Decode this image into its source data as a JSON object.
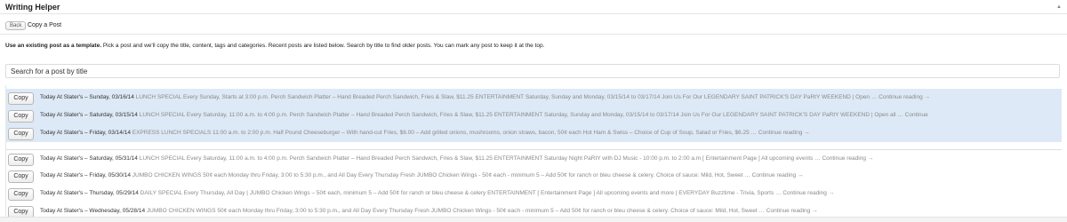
{
  "panel": {
    "title": "Writing Helper",
    "toggle_glyph": "▲"
  },
  "subbar": {
    "back_label": "Back",
    "crumb": "Copy a Post"
  },
  "intro": {
    "bold": "Use an existing post as a template.",
    "rest": " Pick a post and we'll copy the title, content, tags and categories. Recent posts are listed below. Search by title to find older posts. You can mark any post to keep it at the top."
  },
  "search": {
    "placeholder": "Search for a post by title",
    "value": ""
  },
  "copy_label": "Copy",
  "posts": [
    {
      "title": "Today At Slater's – Sunday, 03/16/14",
      "excerpt": "LUNCH SPECIAL Every Sunday, Starts at 3:00 p.m. Perch Sandwich Platter – Hand Breaded Perch Sandwich, Fries & Slaw, $11.25 ENTERTAINMENT Saturday, Sunday and Monday, 03/15/14 to 03/17/14 Join Us For Our LEGENDARY SAINT PATRICK'S DAY PaRtY WEEKEND | Open …",
      "more": "Continue reading →",
      "highlighted": true
    },
    {
      "title": "Today At Slater's – Saturday, 03/15/14",
      "excerpt": "LUNCH SPECIAL Every Saturday, 11:00 a.m. to 4:00 p.m. Perch Sandwich Platter – Hand Breaded Perch Sandwich, Fries & Slaw, $11.25 ENTERTAINMENT Saturday, Sunday and Monday, 03/15/14 to 03/17/14 Join Us For Our LEGENDARY SAINT PATRICK'S DAY PaRtY WEEKEND | Open all …",
      "more": "Continue",
      "highlighted": true
    },
    {
      "title": "Today At Slater's – Friday, 03/14/14",
      "excerpt": "EXPRESS LUNCH SPECIALS 11:00 a.m. to 2:00 p.m. Half Pound Cheeseburger – With hand-cut Fries, $6.00 – Add grilled onions, mushrooms, onion straws, bacon, 50¢ each Hot Ham & Swiss – Choice of Cup of Soup, Salad or Fries, $6.25 …",
      "more": "Continue reading →",
      "highlighted": true
    },
    {
      "title": "Today At Slater's – Saturday, 05/31/14",
      "excerpt": "LUNCH SPECIAL Every Saturday, 11:00 a.m. to 4:00 p.m. Perch Sandwich Platter – Hand Breaded Perch Sandwich, Fries & Slaw, $11.25 ENTERTAINMENT Saturday Night PaRtY with DJ Music - 10:00 p.m. to 2:00 a.m [ Entertainment Page ] All upcoming events …",
      "more": "Continue reading →",
      "highlighted": false
    },
    {
      "title": "Today At Slater's – Friday, 05/30/14",
      "excerpt": "JUMBO CHICKEN WINGS 50¢ each Monday thru Friday, 3:00 to 5:30 p.m., and All Day Every Thursday Fresh JUMBO Chicken Wings - 50¢ each - minimum 5 – Add 50¢ for ranch or bleu cheese & celery. Choice of sauce: Mild, Hot, Sweet …",
      "more": "Continue reading →",
      "highlighted": false
    },
    {
      "title": "Today At Slater's – Thursday, 05/29/14",
      "excerpt": "DAILY SPECIAL Every Thursday, All Day | JUMBO Chicken Wings – 50¢ each, minimum 5 – Add 50¢ for ranch or bleu cheese & celery ENTERTAINMENT [ Entertainment Page ] All upcoming events and more | EVERYDAY Buzztime - Trivia, Sports …",
      "more": "Continue reading →",
      "highlighted": false
    },
    {
      "title": "Today At Slater's – Wednesday, 05/28/14",
      "excerpt": "JUMBO CHICKEN WINGS 50¢ each Monday thru Friday, 3:00 to 5:30 p.m., and All Day Every Thursday Fresh JUMBO Chicken Wings - 50¢ each - minimum 5 – Add 50¢ for ranch or bleu cheese & celery. Choice of sauce: Mild, Hot, Sweet …",
      "more": "Continue reading →",
      "highlighted": false
    }
  ]
}
